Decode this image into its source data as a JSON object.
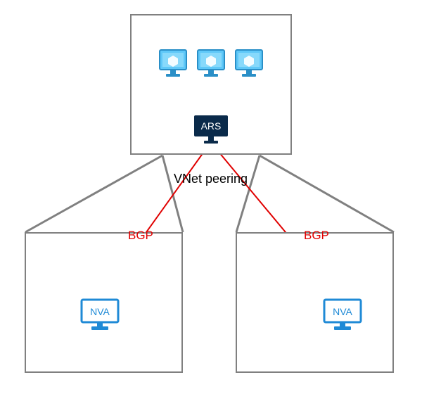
{
  "diagram": {
    "hub": {
      "ars_label": "ARS"
    },
    "spokes": {
      "left": {
        "nva_label": "NVA"
      },
      "right": {
        "nva_label": "NVA"
      }
    },
    "labels": {
      "peering": "VNet peering",
      "bgp": "BGP"
    },
    "colors": {
      "box_border": "#808080",
      "peering_line": "#808080",
      "bgp_line": "#e00000",
      "bgp_text": "#e00000",
      "ars_bg": "#0a2a4a",
      "ars_text": "#ffffff",
      "vm_blue": "#3fb0e8",
      "nva_blue": "#1f8ad6"
    }
  }
}
